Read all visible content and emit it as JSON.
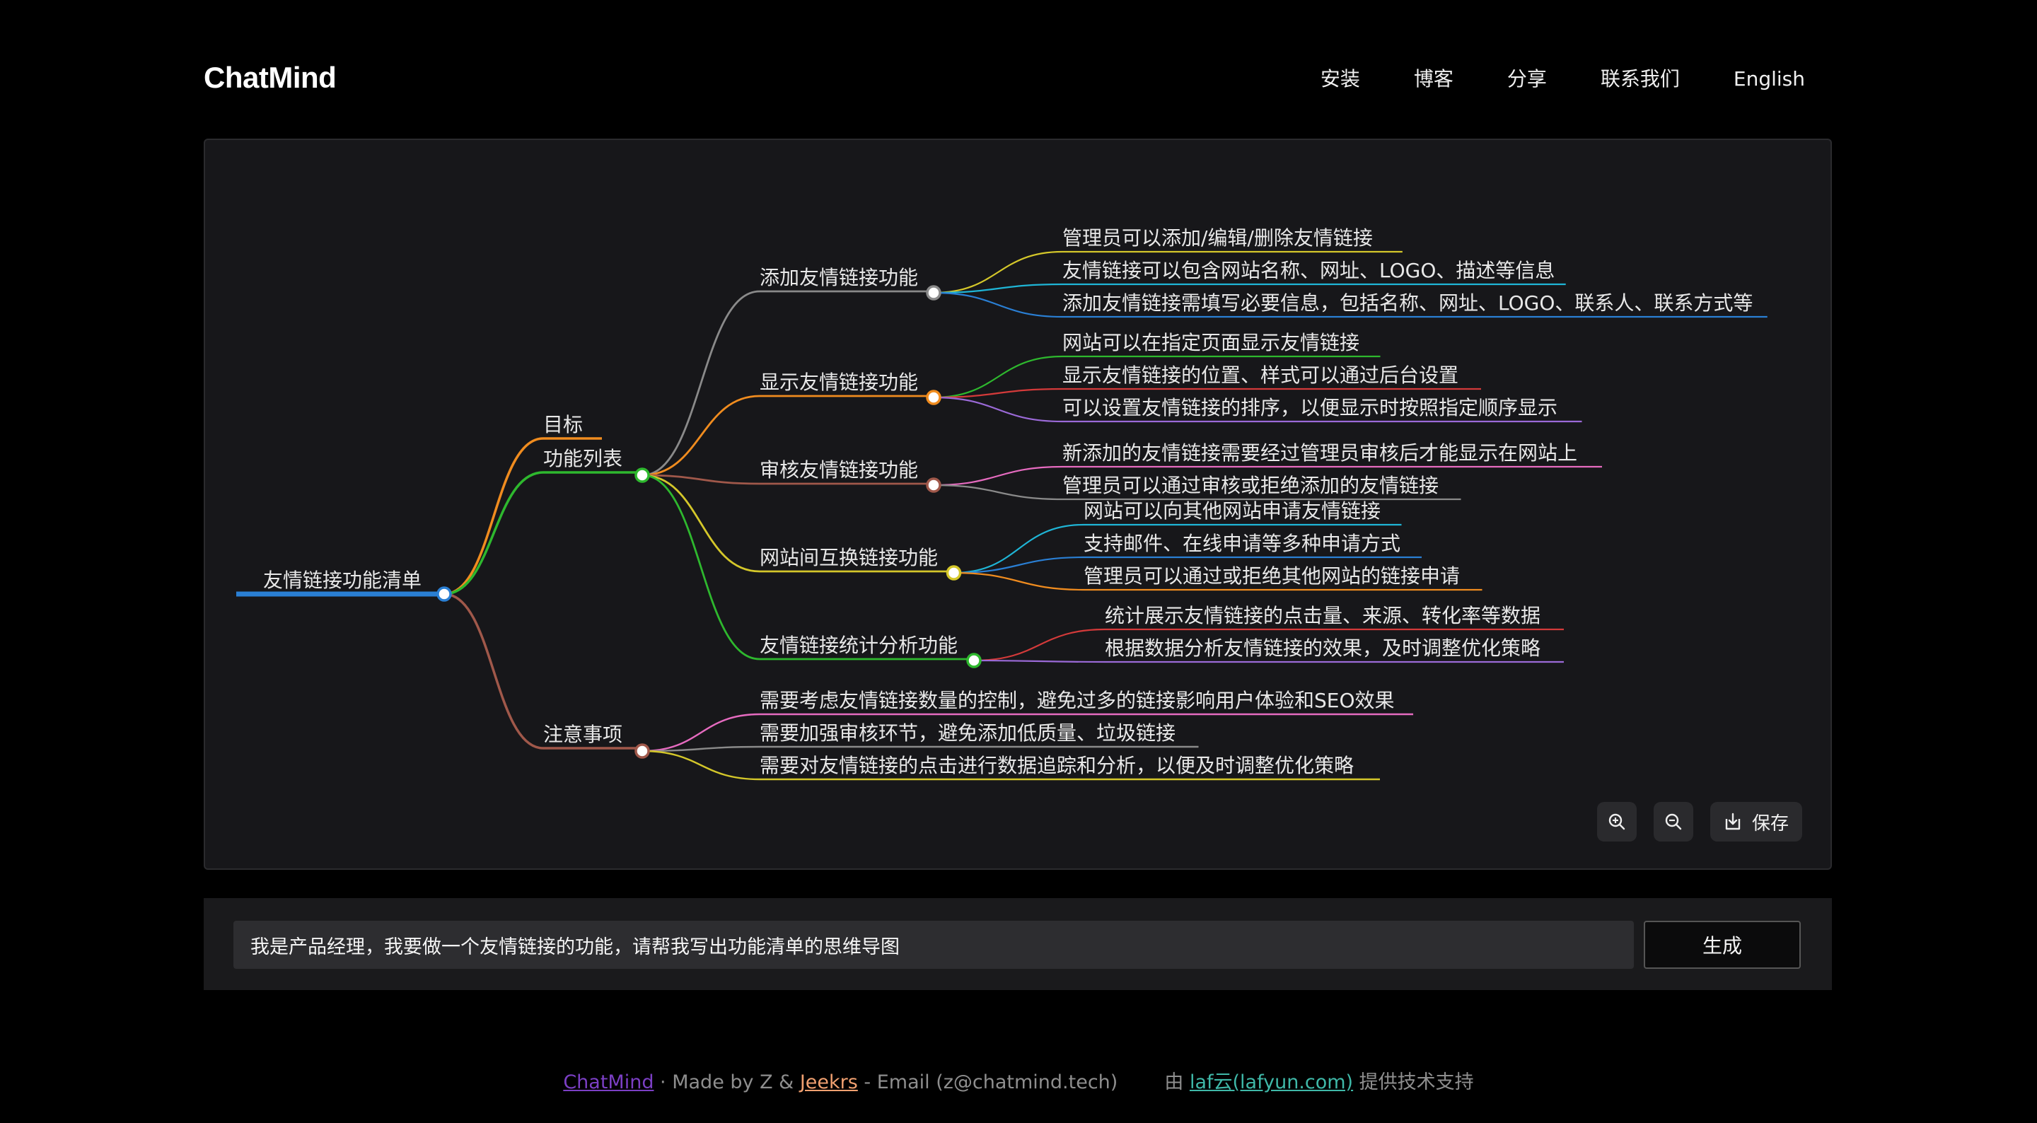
{
  "header": {
    "logo": "ChatMind",
    "nav": [
      "安装",
      "博客",
      "分享",
      "联系我们",
      "English"
    ]
  },
  "mindmap": {
    "root": "友情链接功能清单",
    "branches": [
      {
        "label": "目标",
        "color": "#f08c1f",
        "children": []
      },
      {
        "label": "功能列表",
        "color": "#2eb82e",
        "children": [
          {
            "label": "添加友情链接功能",
            "color": "#8a8a8a",
            "children": [
              {
                "label": "管理员可以添加/编辑/删除友情链接",
                "color": "#d4c72a"
              },
              {
                "label": "友情链接可以包含网站名称、网址、LOGO、描述等信息",
                "color": "#1fb5d6"
              },
              {
                "label": "添加友情链接需填写必要信息，包括名称、网址、LOGO、联系人、联系方式等",
                "color": "#2a7fd4"
              }
            ]
          },
          {
            "label": "显示友情链接功能",
            "color": "#f08c1f",
            "children": [
              {
                "label": "网站可以在指定页面显示友情链接",
                "color": "#2eb82e"
              },
              {
                "label": "显示友情链接的位置、样式可以通过后台设置",
                "color": "#d43a3a"
              },
              {
                "label": "可以设置友情链接的排序，以便显示时按照指定顺序显示",
                "color": "#9b6ad8"
              }
            ]
          },
          {
            "label": "审核友情链接功能",
            "color": "#a0584a",
            "children": [
              {
                "label": "新添加的友情链接需要经过管理员审核后才能显示在网站上",
                "color": "#e66bc0"
              },
              {
                "label": "管理员可以通过审核或拒绝添加的友情链接",
                "color": "#8a8a8a"
              }
            ]
          },
          {
            "label": "网站间互换链接功能",
            "color": "#d4c72a",
            "children": [
              {
                "label": "网站可以向其他网站申请友情链接",
                "color": "#1fb5d6"
              },
              {
                "label": "支持邮件、在线申请等多种申请方式",
                "color": "#2a7fd4"
              },
              {
                "label": "管理员可以通过或拒绝其他网站的链接申请",
                "color": "#f08c1f"
              }
            ]
          },
          {
            "label": "友情链接统计分析功能",
            "color": "#2eb82e",
            "children": [
              {
                "label": "统计展示友情链接的点击量、来源、转化率等数据",
                "color": "#d43a3a"
              },
              {
                "label": "根据数据分析友情链接的效果，及时调整优化策略",
                "color": "#9b6ad8"
              }
            ]
          }
        ]
      },
      {
        "label": "注意事项",
        "color": "#a0584a",
        "children": [
          {
            "label": "需要考虑友情链接数量的控制，避免过多的链接影响用户体验和SEO效果",
            "color": "#e66bc0"
          },
          {
            "label": "需要加强审核环节，避免添加低质量、垃圾链接",
            "color": "#8a8a8a"
          },
          {
            "label": "需要对友情链接的点击进行数据追踪和分析，以便及时调整优化策略",
            "color": "#d4c72a"
          }
        ]
      }
    ]
  },
  "toolbar": {
    "zoom_in_icon": "zoom-in-icon",
    "zoom_out_icon": "zoom-out-icon",
    "save_label": "保存"
  },
  "input": {
    "value": "我是产品经理，我要做一个友情链接的功能，请帮我写出功能清单的思维导图",
    "button": "生成"
  },
  "footer": {
    "link1": "ChatMind",
    "link1_color": "#7b3fc4",
    "made_by": " · Made by Z & ",
    "link2": "Jeekrs",
    "link2_color": "#f0a070",
    "email": " - Email (z@chatmind.tech)",
    "support_prefix": "由 ",
    "link3": "laf云(lafyun.com)",
    "link3_color": "#3fb8a8",
    "support_suffix": " 提供技术支持"
  }
}
